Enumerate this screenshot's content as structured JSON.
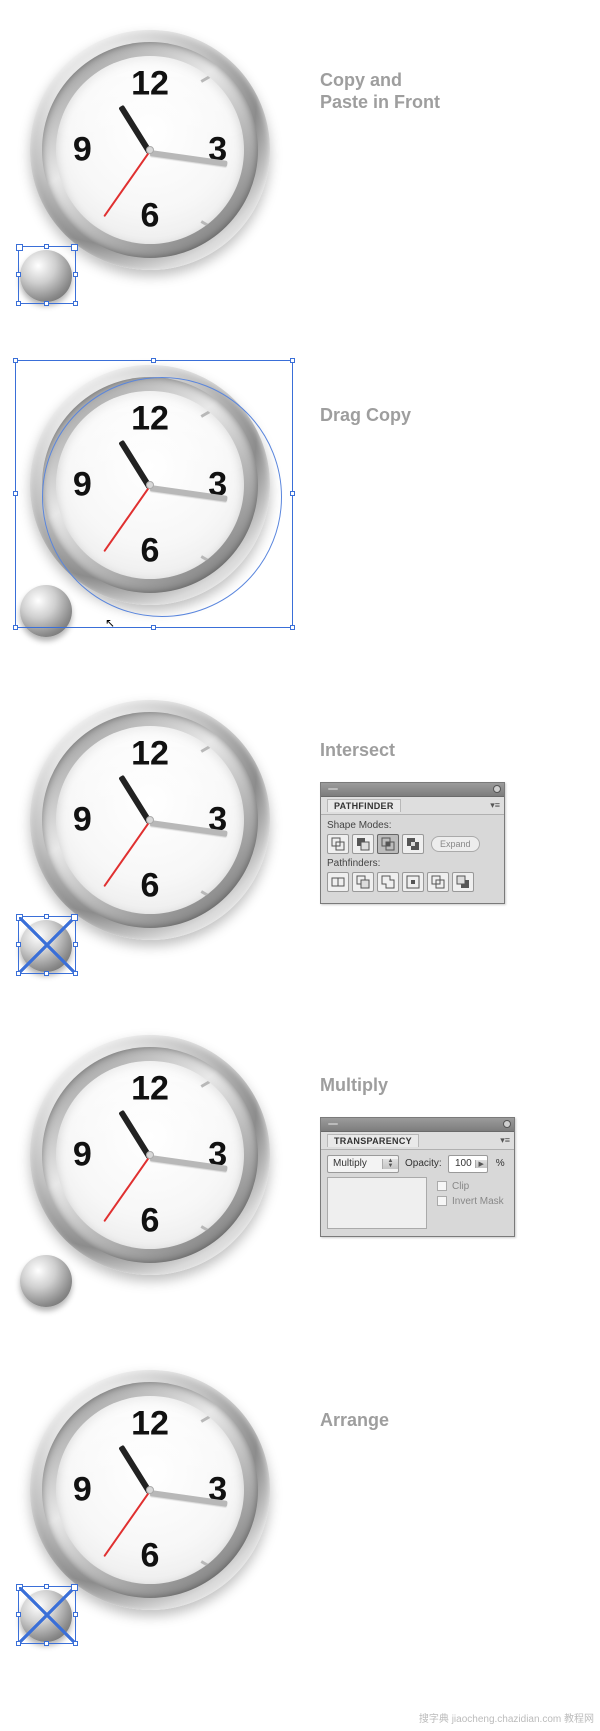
{
  "steps": {
    "s1": {
      "label": "Copy and\nPaste in Front"
    },
    "s2": {
      "label": "Drag Copy"
    },
    "s3": {
      "label": "Intersect"
    },
    "s4": {
      "label": "Multiply"
    },
    "s5": {
      "label": "Arrange"
    }
  },
  "clock": {
    "n12": "12",
    "n3": "3",
    "n6": "6",
    "n9": "9"
  },
  "pathfinder": {
    "title": "PATHFINDER",
    "shape_modes_label": "Shape Modes:",
    "pathfinders_label": "Pathfinders:",
    "expand_label": "Expand"
  },
  "transparency": {
    "title": "TRANSPARENCY",
    "mode": "Multiply",
    "opacity_label": "Opacity:",
    "opacity_value": "100",
    "percent": "%",
    "clip_label": "Clip",
    "invert_label": "Invert Mask"
  },
  "watermark": "搜字典 jiaocheng.chazidian.com 教程网"
}
